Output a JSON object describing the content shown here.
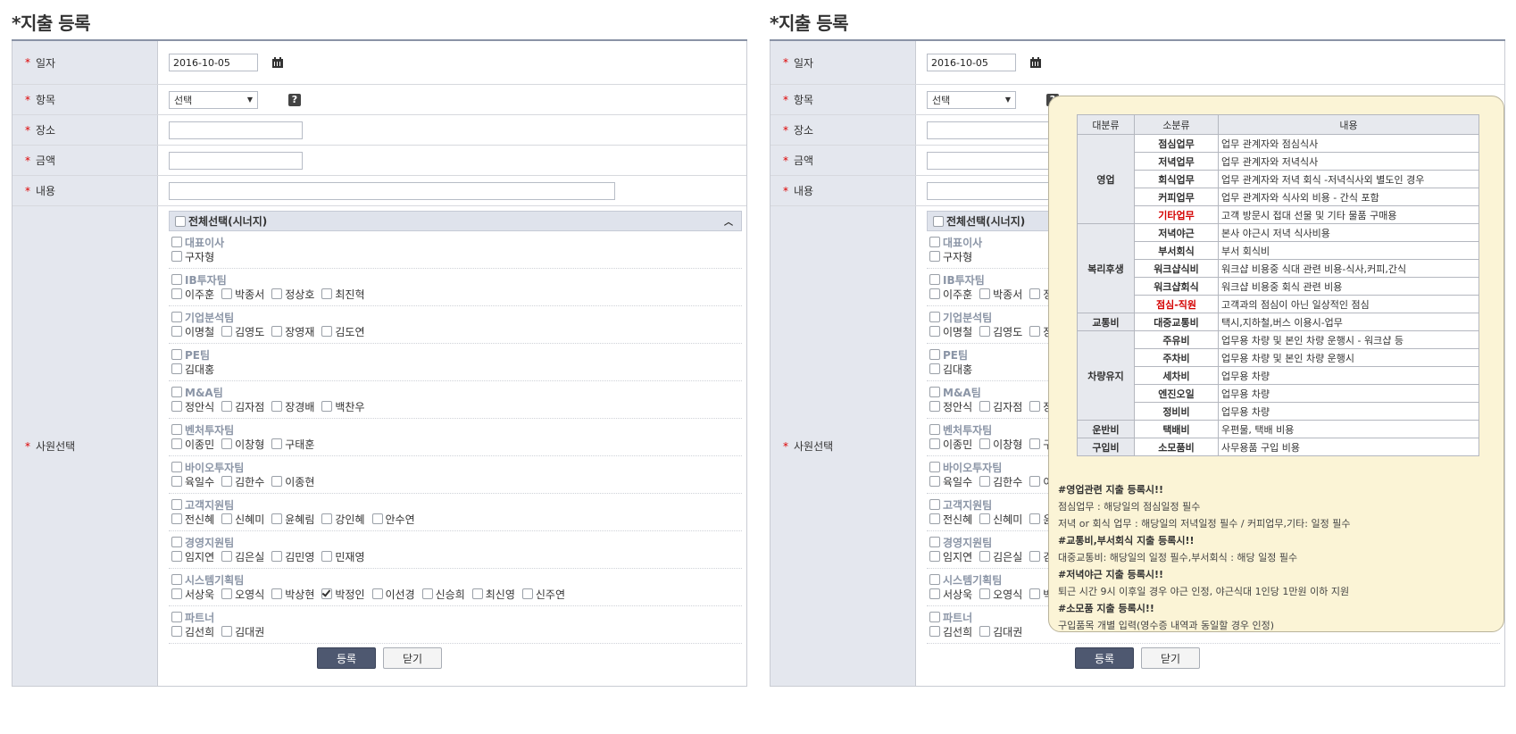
{
  "page": {
    "title": "지출 등록",
    "title_star": "*"
  },
  "form": {
    "date": {
      "label": "일자",
      "value": "2016-10-05"
    },
    "item": {
      "label": "항목",
      "selected": "선택"
    },
    "place": {
      "label": "장소",
      "value": ""
    },
    "amount": {
      "label": "금액",
      "value": ""
    },
    "content": {
      "label": "내용",
      "value": ""
    },
    "employees": {
      "label": "사원선택",
      "all_label": "전체선택(시너지)",
      "groups": [
        {
          "name": "대표이사",
          "members": [
            {
              "name": "구자형",
              "checked": false
            }
          ]
        },
        {
          "name": "IB투자팀",
          "members": [
            {
              "name": "이주훈",
              "checked": false
            },
            {
              "name": "박종서",
              "checked": false
            },
            {
              "name": "정상호",
              "checked": false
            },
            {
              "name": "최진혁",
              "checked": false
            }
          ]
        },
        {
          "name": "기업분석팀",
          "members": [
            {
              "name": "이명철",
              "checked": false
            },
            {
              "name": "김영도",
              "checked": false
            },
            {
              "name": "장영재",
              "checked": false
            },
            {
              "name": "김도연",
              "checked": false
            }
          ]
        },
        {
          "name": "PE팀",
          "members": [
            {
              "name": "김대홍",
              "checked": false
            }
          ]
        },
        {
          "name": "M&A팀",
          "members": [
            {
              "name": "정안식",
              "checked": false
            },
            {
              "name": "김자점",
              "checked": false
            },
            {
              "name": "장경배",
              "checked": false
            },
            {
              "name": "백찬우",
              "checked": false
            }
          ]
        },
        {
          "name": "벤처투자팀",
          "members": [
            {
              "name": "이종민",
              "checked": false
            },
            {
              "name": "이창형",
              "checked": false
            },
            {
              "name": "구태훈",
              "checked": false
            }
          ]
        },
        {
          "name": "바이오투자팀",
          "members": [
            {
              "name": "육일수",
              "checked": false
            },
            {
              "name": "김한수",
              "checked": false
            },
            {
              "name": "이종현",
              "checked": false
            }
          ]
        },
        {
          "name": "고객지원팀",
          "members": [
            {
              "name": "전신혜",
              "checked": false
            },
            {
              "name": "신혜미",
              "checked": false
            },
            {
              "name": "윤혜림",
              "checked": false
            },
            {
              "name": "강인혜",
              "checked": false
            },
            {
              "name": "안수연",
              "checked": false
            }
          ]
        },
        {
          "name": "경영지원팀",
          "members": [
            {
              "name": "임지연",
              "checked": false
            },
            {
              "name": "김은실",
              "checked": false
            },
            {
              "name": "김민영",
              "checked": false
            },
            {
              "name": "민재영",
              "checked": false
            }
          ]
        },
        {
          "name": "시스템기획팀",
          "members": [
            {
              "name": "서상욱",
              "checked": false
            },
            {
              "name": "오영식",
              "checked": false
            },
            {
              "name": "박상현",
              "checked": false
            },
            {
              "name": "박정인",
              "checked": true
            },
            {
              "name": "이선경",
              "checked": false
            },
            {
              "name": "신승희",
              "checked": false
            },
            {
              "name": "최신영",
              "checked": false
            },
            {
              "name": "신주연",
              "checked": false
            }
          ]
        },
        {
          "name": "파트너",
          "members": [
            {
              "name": "김선희",
              "checked": false
            },
            {
              "name": "김대권",
              "checked": false
            }
          ]
        }
      ]
    }
  },
  "buttons": {
    "submit": "등록",
    "close": "닫기"
  },
  "tooltip": {
    "headers": [
      "대분류",
      "소분류",
      "내용"
    ],
    "categories": [
      {
        "name": "영업",
        "rows": [
          {
            "sub": "점심업무",
            "desc": "업무 관계자와 점심식사",
            "red": false
          },
          {
            "sub": "저녁업무",
            "desc": "업무 관계자와 저녁식사",
            "red": false
          },
          {
            "sub": "회식업무",
            "desc": "업무 관계자와 저녁 회식 -저녁식사외 별도인 경우",
            "red": false
          },
          {
            "sub": "커피업무",
            "desc": "업무 관계자와 식사외 비용 - 간식 포함",
            "red": false
          },
          {
            "sub": "기타업무",
            "desc": "고객 방문시 접대 선물 및 기타 물품 구매용",
            "red": true
          }
        ]
      },
      {
        "name": "복리후생",
        "rows": [
          {
            "sub": "저녁야근",
            "desc": "본사 야근시 저녁 식사비용",
            "red": false
          },
          {
            "sub": "부서회식",
            "desc": "부서 회식비",
            "red": false
          },
          {
            "sub": "워크샵식비",
            "desc": "워크샵 비용중 식대 관련 비용-식사,커피,간식",
            "red": false
          },
          {
            "sub": "워크샵회식",
            "desc": "워크샵 비용중 회식 관련 비용",
            "red": false
          },
          {
            "sub": "점심-직원",
            "desc": "고객과의 점심이 아닌 일상적인 점심",
            "red": true
          }
        ]
      },
      {
        "name": "교통비",
        "rows": [
          {
            "sub": "대중교통비",
            "desc": "택시,지하철,버스 이용시-업무",
            "red": false
          }
        ]
      },
      {
        "name": "차량유지",
        "rows": [
          {
            "sub": "주유비",
            "desc": "업무용 차량 및 본인 차량 운행시 - 워크샵 등",
            "red": false
          },
          {
            "sub": "주차비",
            "desc": "업무용 차량 및 본인 차량 운행시",
            "red": false
          },
          {
            "sub": "세차비",
            "desc": "업무용 차량",
            "red": false
          },
          {
            "sub": "엔진오일",
            "desc": "업무용 차량",
            "red": false
          },
          {
            "sub": "정비비",
            "desc": "업무용 차량",
            "red": false
          }
        ]
      },
      {
        "name": "운반비",
        "rows": [
          {
            "sub": "택배비",
            "desc": "우편물, 택배 비용",
            "red": false
          }
        ]
      },
      {
        "name": "구입비",
        "rows": [
          {
            "sub": "소모품비",
            "desc": "사무용품 구입 비용",
            "red": false
          }
        ]
      }
    ],
    "notes": [
      {
        "text": "#영업관련 지출 등록시!!",
        "heading": true
      },
      {
        "text": "점심업무 : 해당일의 점심일정 필수",
        "heading": false
      },
      {
        "text": "저녁 or 회식 업무 : 해당일의 저녁일정 필수 / 커피업무,기타: 일정 필수",
        "heading": false
      },
      {
        "text": "#교통비,부서회식 지출 등록시!!",
        "heading": true
      },
      {
        "text": "대중교통비: 해당일의 일정 필수,부서회식 : 해당 일정 필수",
        "heading": false
      },
      {
        "text": "#저녁야근 지출 등록시!!",
        "heading": true
      },
      {
        "text": "퇴근 시간 9시 이후일 경우 야근 인정, 야근식대 1인당 1만원 이하 지원",
        "heading": false
      },
      {
        "text": "#소모품 지출 등록시!!",
        "heading": true
      },
      {
        "text": "구입품목 개별 입력(영수증 내역과 동일할 경우 인정)",
        "heading": false
      }
    ]
  },
  "colors": {
    "required": "#dd0000",
    "label_bg": "#e4e7ee",
    "primary_btn": "#4e5870",
    "tooltip_bg": "#fbf4d6",
    "red_text": "#d40000"
  }
}
